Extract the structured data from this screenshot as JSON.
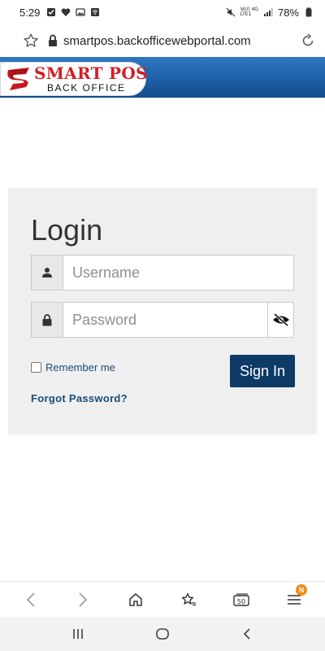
{
  "status_bar": {
    "time": "5:29",
    "network_top": "Vo)) 4G",
    "network_bottom": "LTE1",
    "battery": "78%"
  },
  "browser": {
    "url": "smartpos.backofficewebportal.com",
    "tab_count": "50",
    "menu_badge": "N"
  },
  "header": {
    "logo_title": "SMART POS",
    "logo_subtitle": "BACK OFFICE",
    "brand_color": "#d21f26",
    "bar_color": "#1d5fa8"
  },
  "login": {
    "title": "Login",
    "username_placeholder": "Username",
    "password_placeholder": "Password",
    "remember_label": "Remember me",
    "sign_in_label": "Sign In",
    "forgot_label": "Forgot Password?"
  },
  "icons": {
    "username_addon": "user-icon",
    "password_addon": "lock-icon",
    "password_toggle": "eye-slash-icon"
  }
}
